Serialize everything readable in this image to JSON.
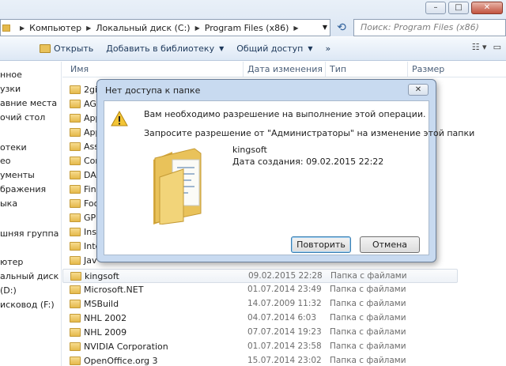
{
  "address": {
    "crumbs": [
      "Компьютер",
      "Локальный диск (C:)",
      "Program Files (x86)"
    ],
    "search_placeholder": "Поиск: Program Files (x86)"
  },
  "window_controls": {
    "minimize": "–",
    "maximize": "□",
    "close": "✕"
  },
  "toolbar": {
    "open": "Открыть",
    "add_to_library": "Добавить в библиотеку",
    "share": "Общий доступ",
    "more": "»"
  },
  "nav": {
    "items": [
      "нное",
      "узки",
      "авние места",
      "очий стол",
      "отеки",
      "ео",
      "ументы",
      "бражения",
      "ыка",
      "шняя группа",
      "ютер",
      "альный диск (С",
      "(D:)",
      "исковод (F:)"
    ]
  },
  "columns": {
    "name": "Имя",
    "date": "Дата изменения",
    "type": "Тип",
    "size": "Размер"
  },
  "files": [
    {
      "name": "2gis",
      "date": "",
      "type": ""
    },
    {
      "name": "AG",
      "date": "",
      "type": ""
    },
    {
      "name": "App",
      "date": "",
      "type": ""
    },
    {
      "name": "App",
      "date": "",
      "type": ""
    },
    {
      "name": "Ass",
      "date": "",
      "type": ""
    },
    {
      "name": "Com",
      "date": "",
      "type": ""
    },
    {
      "name": "DA",
      "date": "",
      "type": ""
    },
    {
      "name": "Fin",
      "date": "",
      "type": ""
    },
    {
      "name": "Foo",
      "date": "",
      "type": ""
    },
    {
      "name": "GPL",
      "date": "",
      "type": ""
    },
    {
      "name": "Inst",
      "date": "",
      "type": ""
    },
    {
      "name": "Inte",
      "date": "",
      "type": ""
    },
    {
      "name": "Jav",
      "date": "",
      "type": ""
    },
    {
      "name": "kingsoft",
      "date": "09.02.2015 22:28",
      "type": "Папка с файлами"
    },
    {
      "name": "Microsoft.NET",
      "date": "01.07.2014 23:49",
      "type": "Папка с файлами"
    },
    {
      "name": "MSBuild",
      "date": "14.07.2009 11:32",
      "type": "Папка с файлами"
    },
    {
      "name": "NHL 2002",
      "date": "04.07.2014 6:03",
      "type": "Папка с файлами"
    },
    {
      "name": "NHL 2009",
      "date": "07.07.2014 19:23",
      "type": "Папка с файлами"
    },
    {
      "name": "NVIDIA Corporation",
      "date": "01.07.2014 23:58",
      "type": "Папка с файлами"
    },
    {
      "name": "OpenOffice.org 3",
      "date": "15.07.2014 23:02",
      "type": "Папка с файлами"
    }
  ],
  "dialog": {
    "title": "Нет доступа к папке",
    "message": "Вам необходимо разрешение на выполнение этой операции.",
    "request": "Запросите разрешение от \"Администраторы\" на изменение этой папки",
    "folder_name": "kingsoft",
    "folder_date": "Дата создания: 09.02.2015 22:22",
    "retry": "Повторить",
    "cancel": "Отмена",
    "close": "✕"
  }
}
